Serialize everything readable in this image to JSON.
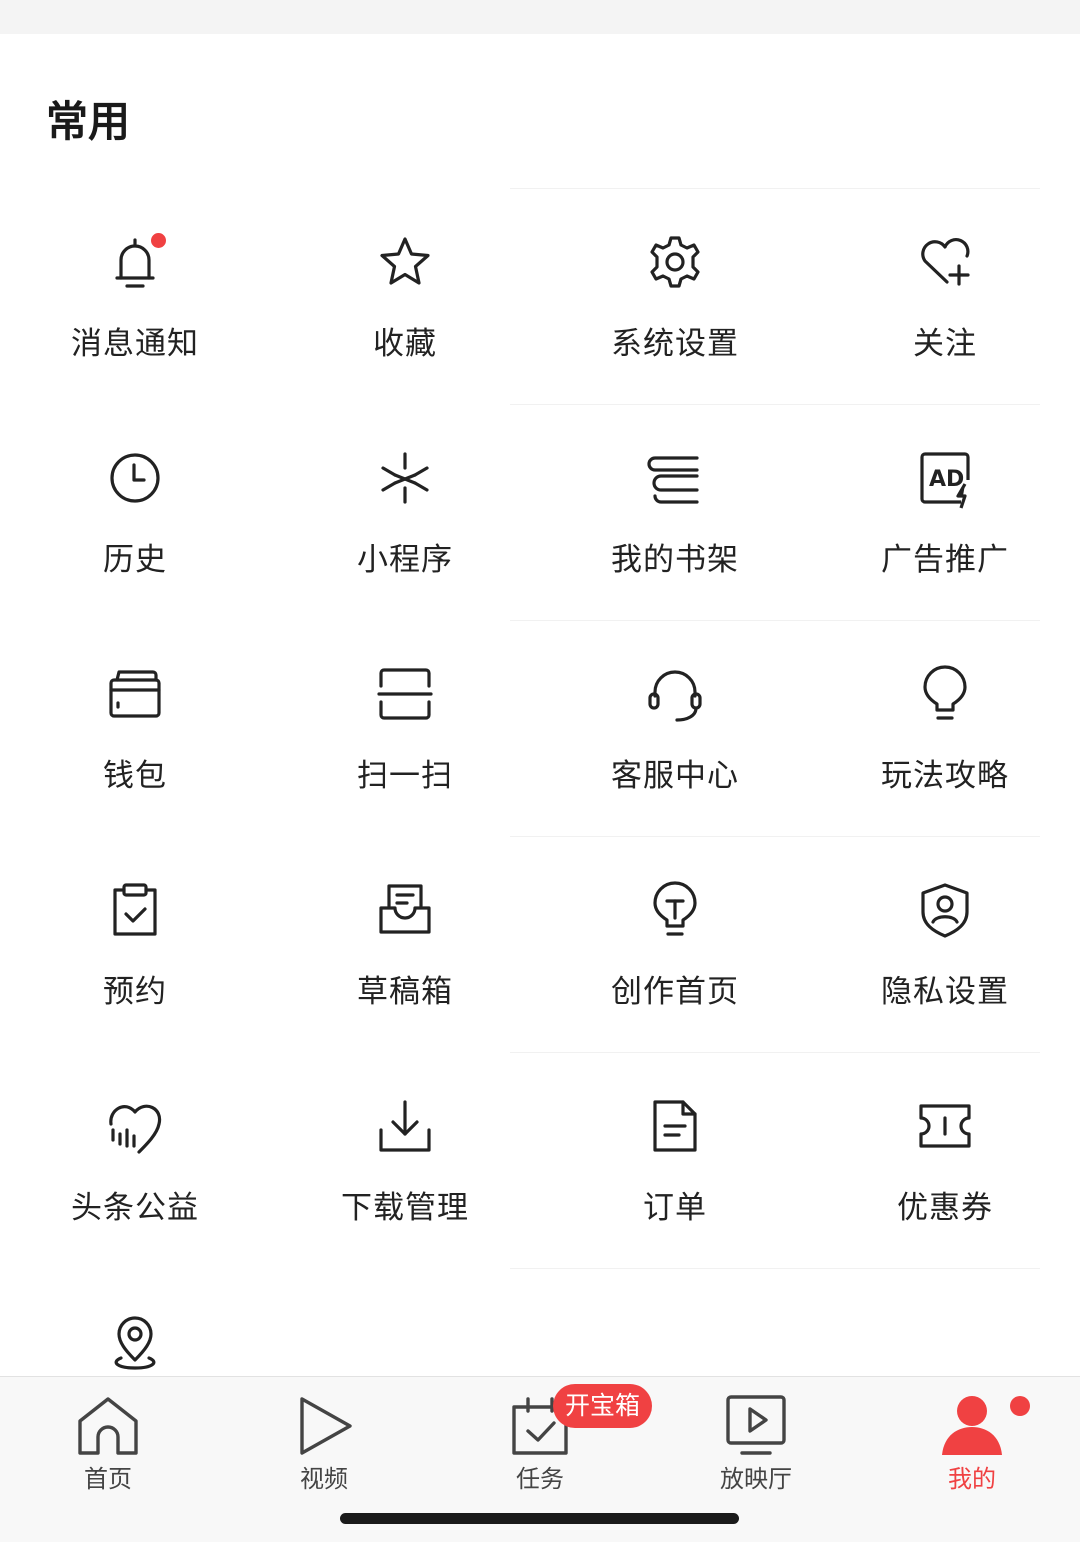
{
  "colors": {
    "accent": "#f04142",
    "icon_stroke": "#222222"
  },
  "section": {
    "title": "常用"
  },
  "grid": {
    "row1": [
      {
        "label": "消息通知",
        "icon": "bell-icon",
        "has_dot": true
      },
      {
        "label": "收藏",
        "icon": "star-icon"
      },
      {
        "label": "系统设置",
        "icon": "gear-icon"
      },
      {
        "label": "关注",
        "icon": "heart-plus-icon"
      }
    ],
    "row2": [
      {
        "label": "历史",
        "icon": "clock-icon"
      },
      {
        "label": "小程序",
        "icon": "mini-program-icon"
      },
      {
        "label": "我的书架",
        "icon": "bookshelf-icon"
      },
      {
        "label": "广告推广",
        "icon": "ad-icon"
      }
    ],
    "row3": [
      {
        "label": "钱包",
        "icon": "wallet-icon"
      },
      {
        "label": "扫一扫",
        "icon": "scan-icon"
      },
      {
        "label": "客服中心",
        "icon": "headset-icon"
      },
      {
        "label": "玩法攻略",
        "icon": "lightbulb-icon"
      }
    ],
    "row4": [
      {
        "label": "预约",
        "icon": "clipboard-check-icon"
      },
      {
        "label": "草稿箱",
        "icon": "draft-box-icon"
      },
      {
        "label": "创作首页",
        "icon": "creator-bulb-icon"
      },
      {
        "label": "隐私设置",
        "icon": "shield-user-icon"
      }
    ],
    "row5": [
      {
        "label": "头条公益",
        "icon": "charity-heart-icon"
      },
      {
        "label": "下载管理",
        "icon": "download-icon"
      },
      {
        "label": "订单",
        "icon": "order-document-icon"
      },
      {
        "label": "优惠券",
        "icon": "coupon-icon"
      }
    ],
    "row6": [
      {
        "label": "",
        "icon": "location-pin-icon"
      }
    ]
  },
  "tabbar": {
    "tabs": [
      {
        "label": "首页",
        "icon": "home-icon",
        "active": false
      },
      {
        "label": "视频",
        "icon": "play-icon",
        "active": false
      },
      {
        "label": "任务",
        "icon": "task-calendar-icon",
        "active": false
      },
      {
        "label": "放映厅",
        "icon": "tv-play-icon",
        "active": false
      },
      {
        "label": "我的",
        "icon": "user-icon",
        "active": true
      }
    ],
    "task_badge": "开宝箱"
  }
}
